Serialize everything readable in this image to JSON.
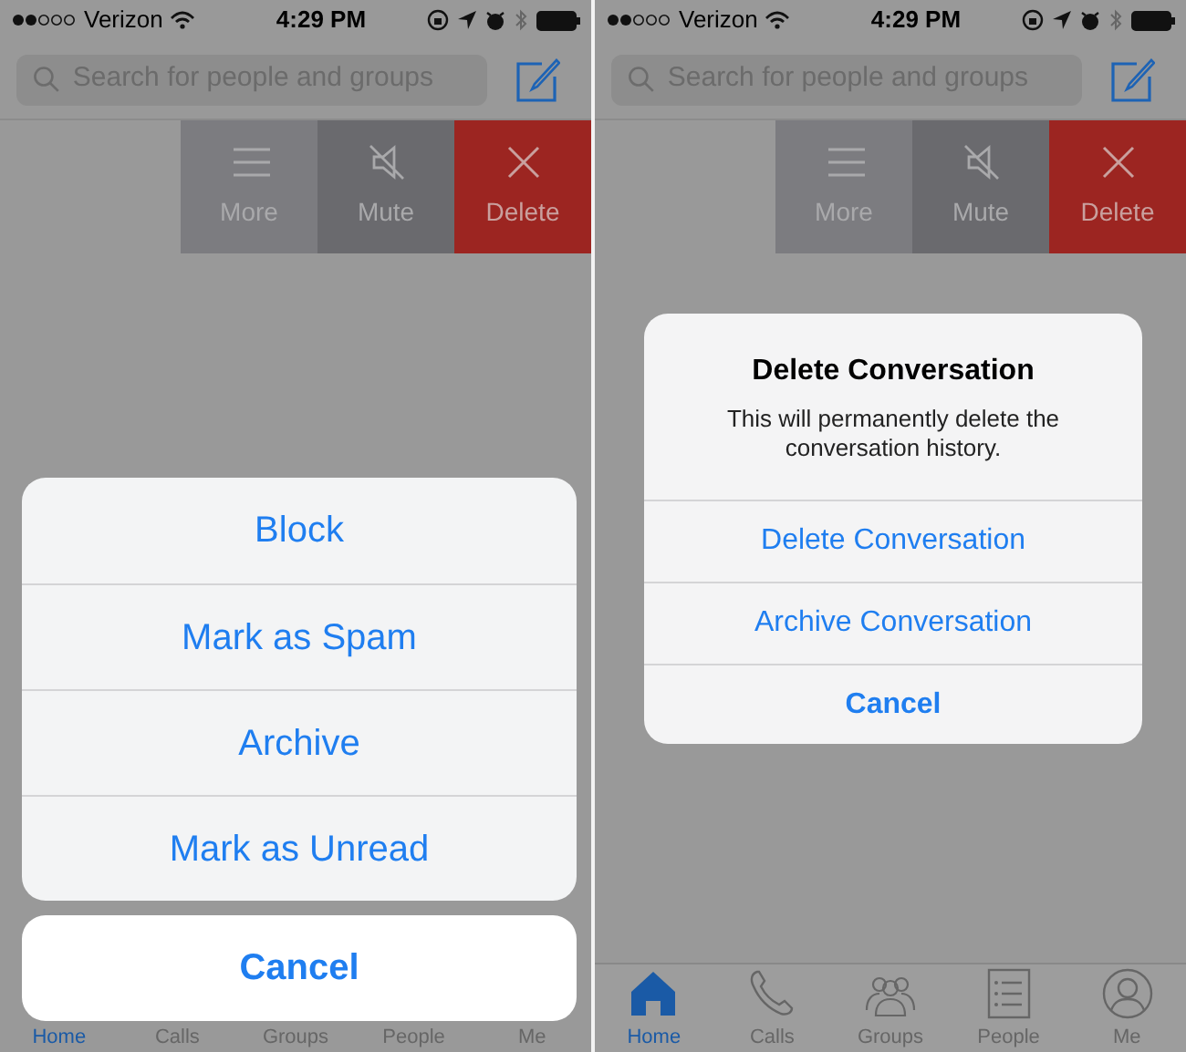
{
  "screens": [
    {
      "status_bar": {
        "carrier": "Verizon",
        "time": "4:29 PM"
      },
      "search": {
        "placeholder": "Search for people and groups"
      },
      "swipe_actions": [
        {
          "kind": "more",
          "label": "More"
        },
        {
          "kind": "mute",
          "label": "Mute"
        },
        {
          "kind": "delete",
          "label": "Delete"
        }
      ],
      "overlay": {
        "kind": "action_sheet",
        "options": [
          "Block",
          "Mark as Spam",
          "Archive",
          "Mark as Unread"
        ],
        "cancel": "Cancel"
      },
      "tab_bar": [
        {
          "label": "Home",
          "selected": true
        },
        {
          "label": "Calls",
          "selected": false
        },
        {
          "label": "Groups",
          "selected": false
        },
        {
          "label": "People",
          "selected": false
        },
        {
          "label": "Me",
          "selected": false
        }
      ]
    },
    {
      "status_bar": {
        "carrier": "Verizon",
        "time": "4:29 PM"
      },
      "search": {
        "placeholder": "Search for people and groups"
      },
      "swipe_actions": [
        {
          "kind": "more",
          "label": "More"
        },
        {
          "kind": "mute",
          "label": "Mute"
        },
        {
          "kind": "delete",
          "label": "Delete"
        }
      ],
      "overlay": {
        "kind": "alert",
        "title": "Delete Conversation",
        "message": "This will permanently delete the conversation history.",
        "buttons": [
          "Delete Conversation",
          "Archive Conversation"
        ],
        "cancel": "Cancel"
      },
      "tab_bar": [
        {
          "kind": "home",
          "label": "Home",
          "selected": true
        },
        {
          "kind": "calls",
          "label": "Calls",
          "selected": false
        },
        {
          "kind": "groups",
          "label": "Groups",
          "selected": false
        },
        {
          "kind": "people",
          "label": "People",
          "selected": false
        },
        {
          "kind": "me",
          "label": "Me",
          "selected": false
        }
      ]
    }
  ]
}
